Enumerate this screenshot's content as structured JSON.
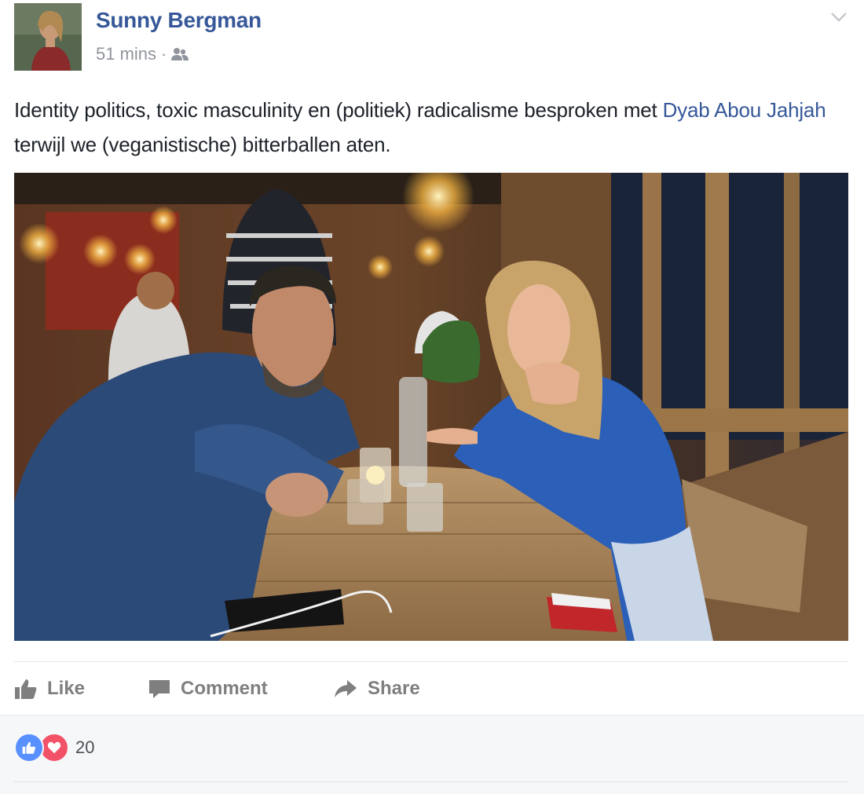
{
  "author": {
    "name": "Sunny Bergman",
    "timestamp": "51 mins",
    "separator": "·",
    "audience_icon": "friends-icon"
  },
  "post": {
    "text_before": "Identity politics, toxic masculinity en (politiek) radicalisme besproken met ",
    "mention": "Dyab Abou Jahjah",
    "text_after": " terwijl we (veganistische) bitterballen aten.",
    "photo_icon": "photo"
  },
  "actions": {
    "like": "Like",
    "comment": "Comment",
    "share": "Share"
  },
  "reactions": {
    "icons": [
      "like-reaction-icon",
      "love-reaction-icon"
    ],
    "count": "20"
  },
  "colors": {
    "link": "#365899",
    "meta": "#90949c",
    "action": "#7f7f7f",
    "like_blue": "#5890ff",
    "love_red": "#f25268"
  }
}
